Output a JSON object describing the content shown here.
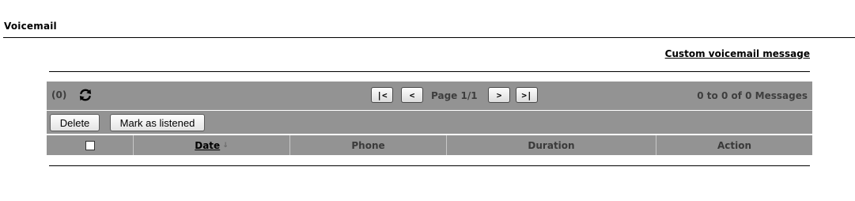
{
  "page": {
    "title": "Voicemail",
    "custom_link": "Custom voicemail message"
  },
  "toolbar": {
    "count": "(0)",
    "refresh_icon": "refresh-icon",
    "pager": {
      "first": "|<",
      "prev": "<",
      "page_label": "Page 1/1",
      "next": ">",
      "last": ">|"
    },
    "range_label": "0 to 0 of 0 Messages"
  },
  "actions": {
    "delete": "Delete",
    "mark_listened": "Mark as listened"
  },
  "table": {
    "columns": {
      "date": "Date",
      "date_sort": "↓",
      "phone": "Phone",
      "duration": "Duration",
      "action": "Action"
    }
  }
}
